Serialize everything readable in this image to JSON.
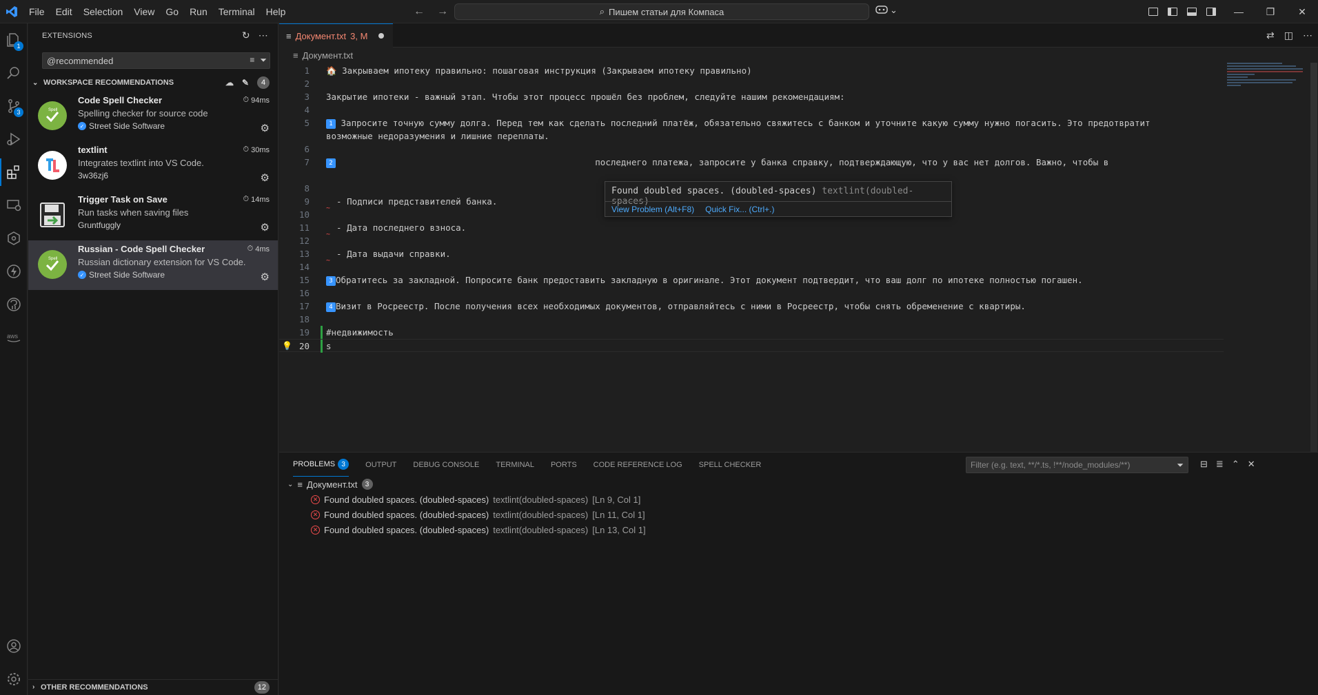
{
  "titlebar": {
    "menu": [
      "File",
      "Edit",
      "Selection",
      "View",
      "Go",
      "Run",
      "Terminal",
      "Help"
    ],
    "search_text": "Пишем статьи для Компаса"
  },
  "activity": {
    "explorer_badge": "1",
    "scm_badge": "3"
  },
  "sidebar": {
    "title": "EXTENSIONS",
    "search_value": "@recommended",
    "section_title": "WORKSPACE RECOMMENDATIONS",
    "section_count": "4",
    "extensions": [
      {
        "name": "Code Spell Checker",
        "desc": "Spelling checker for source code",
        "publisher": "Street Side Software",
        "time": "94ms",
        "verified": true
      },
      {
        "name": "textlint",
        "desc": "Integrates textlint into VS Code.",
        "publisher": "3w36zj6",
        "time": "30ms",
        "verified": false
      },
      {
        "name": "Trigger Task on Save",
        "desc": "Run tasks when saving files",
        "publisher": "Gruntfuggly",
        "time": "14ms",
        "verified": false
      },
      {
        "name": "Russian - Code Spell Checker",
        "desc": "Russian dictionary extension for VS Code.",
        "publisher": "Street Side Software",
        "time": "4ms",
        "verified": true
      }
    ],
    "other_title": "OTHER RECOMMENDATIONS",
    "other_count": "12"
  },
  "editor": {
    "tab_label": "Документ.txt",
    "tab_status": "3, M",
    "breadcrumb": "Документ.txt",
    "lines": [
      {
        "n": "1",
        "t": "🏠 Закрываем ипотеку правильно: пошаговая инструкция (Закрываем ипотеку правильно)"
      },
      {
        "n": "2",
        "t": ""
      },
      {
        "n": "3",
        "t": "Закрытие ипотеки - важный этап. Чтобы этот процесс прошёл без проблем, следуйте нашим рекомендациям:"
      },
      {
        "n": "4",
        "t": ""
      },
      {
        "n": "5",
        "t": " Запросите точную сумму долга. Перед тем как сделать последний платёж, обязательно свяжитесь с банком и уточните какую сумму нужно погасить. Это предотвратит"
      },
      {
        "n": "",
        "t": "возможные недоразумения и лишние переплаты."
      },
      {
        "n": "6",
        "t": ""
      },
      {
        "n": "7",
        "t": "                                                  последнего платежа, запросите у банка справку, подтверждающую, что у вас нет долгов. Важно, чтобы в"
      },
      {
        "n": "",
        "t": ""
      },
      {
        "n": "8",
        "t": ""
      },
      {
        "n": "9",
        "t": "  - Подписи представителей банка."
      },
      {
        "n": "10",
        "t": ""
      },
      {
        "n": "11",
        "t": "  - Дата последнего взноса."
      },
      {
        "n": "12",
        "t": ""
      },
      {
        "n": "13",
        "t": "  - Дата выдачи справки."
      },
      {
        "n": "14",
        "t": ""
      },
      {
        "n": "15",
        "t": "Обратитесь за закладной. Попросите банк предоставить закладную в оригинале. Этот документ подтвердит, что ваш долг по ипотеке полностью погашен."
      },
      {
        "n": "16",
        "t": ""
      },
      {
        "n": "17",
        "t": "Визит в Росреестр. После получения всех необходимых документов, отправляйтесь с ними в Росреестр, чтобы снять обременение с квартиры."
      },
      {
        "n": "18",
        "t": ""
      },
      {
        "n": "19",
        "t": "#недвижимость"
      },
      {
        "n": "20",
        "t": "s"
      }
    ],
    "hover": {
      "message": "Found doubled spaces. (doubled-spaces)",
      "source": "textlint(doubled-spaces)",
      "view_problem": "View Problem (Alt+F8)",
      "quick_fix": "Quick Fix... (Ctrl+.)"
    }
  },
  "panel": {
    "tabs": [
      "PROBLEMS",
      "OUTPUT",
      "DEBUG CONSOLE",
      "TERMINAL",
      "PORTS",
      "CODE REFERENCE LOG",
      "SPELL CHECKER"
    ],
    "problems_count": "3",
    "filter_placeholder": "Filter (e.g. text, **/*.ts, !**/node_modules/**)",
    "file": "Документ.txt",
    "file_count": "3",
    "problems": [
      {
        "msg": "Found doubled spaces. (doubled-spaces)",
        "src": "textlint(doubled-spaces)",
        "loc": "[Ln 9, Col 1]"
      },
      {
        "msg": "Found doubled spaces. (doubled-spaces)",
        "src": "textlint(doubled-spaces)",
        "loc": "[Ln 11, Col 1]"
      },
      {
        "msg": "Found doubled spaces. (doubled-spaces)",
        "src": "textlint(doubled-spaces)",
        "loc": "[Ln 13, Col 1]"
      }
    ]
  }
}
